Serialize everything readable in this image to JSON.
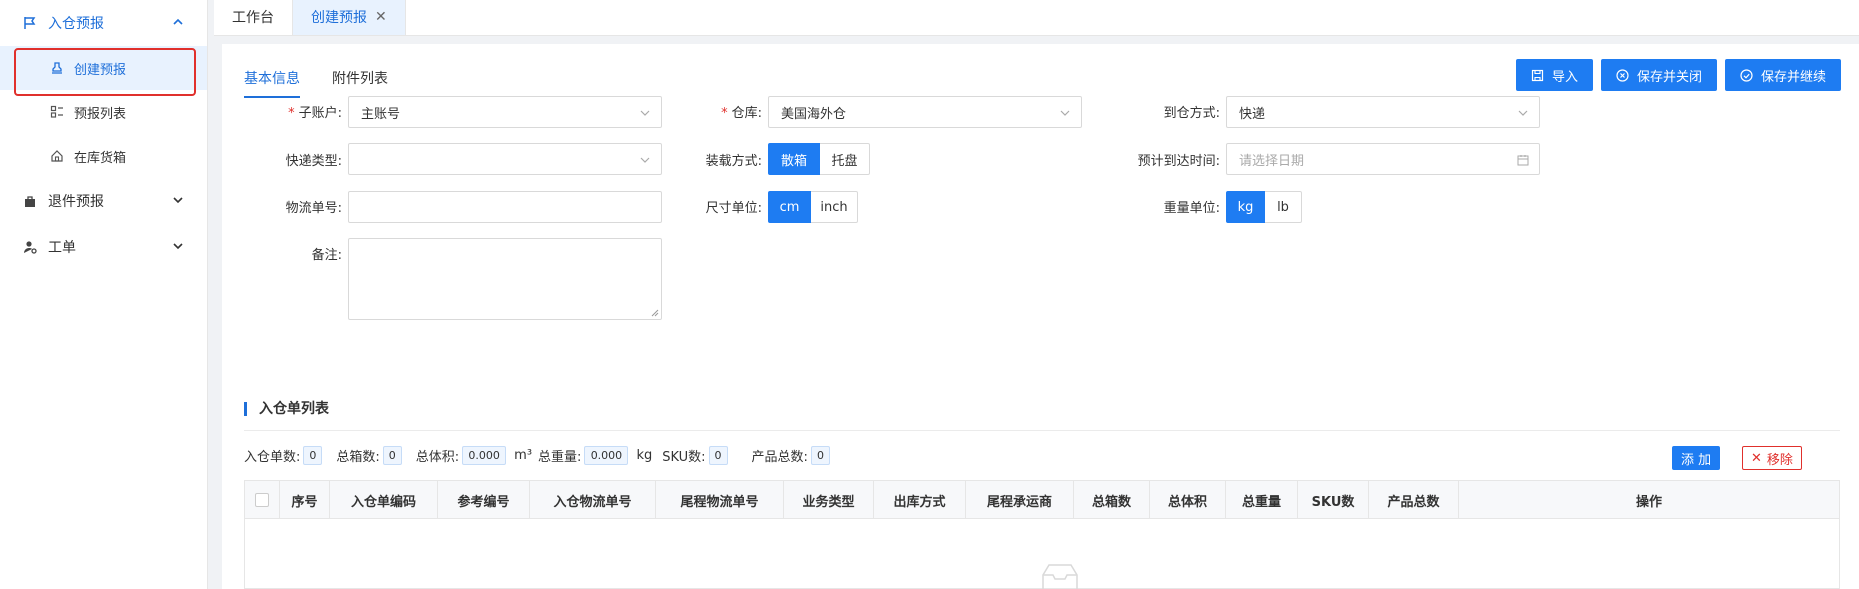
{
  "sidebar": {
    "groups": [
      {
        "label": "入仓预报",
        "icon": "flag-icon",
        "expanded": true
      },
      {
        "label": "退件预报",
        "icon": "bag-icon",
        "expanded": false
      },
      {
        "label": "工单",
        "icon": "user-gear-icon",
        "expanded": false
      }
    ],
    "items": [
      {
        "label": "创建预报",
        "icon": "stamp-icon",
        "active": true
      },
      {
        "label": "预报列表",
        "icon": "list-icon",
        "active": false
      },
      {
        "label": "在库货箱",
        "icon": "home-icon",
        "active": false
      }
    ]
  },
  "tabs": {
    "workbench": "工作台",
    "create": "创建预报"
  },
  "subtabs": {
    "basic": "基本信息",
    "attachments": "附件列表"
  },
  "actions": {
    "import": "导入",
    "save_close": "保存并关闭",
    "save_continue": "保存并继续"
  },
  "form": {
    "sub_account_label": "子账户:",
    "sub_account_value": "主账号",
    "warehouse_label": "仓库:",
    "warehouse_value": "美国海外仓",
    "arrival_mode_label": "到仓方式:",
    "arrival_mode_value": "快递",
    "express_type_label": "快递类型:",
    "express_type_value": "",
    "loading_label": "装载方式:",
    "loading_options": [
      "散箱",
      "托盘"
    ],
    "eta_label": "预计到达时间:",
    "eta_placeholder": "请选择日期",
    "tracking_label": "物流单号:",
    "tracking_value": "",
    "size_unit_label": "尺寸单位:",
    "size_unit_options": [
      "cm",
      "inch"
    ],
    "weight_unit_label": "重量单位:",
    "weight_unit_options": [
      "kg",
      "lb"
    ],
    "remark_label": "备注:",
    "remark_value": ""
  },
  "inbound_section": {
    "title": "入仓单列表",
    "stats": {
      "orders_label": "入仓单数:",
      "orders": "0",
      "boxes_label": "总箱数:",
      "boxes": "0",
      "volume_label": "总体积:",
      "volume": "0.000",
      "volume_unit": "m³",
      "weight_label": "总重量:",
      "weight": "0.000",
      "weight_unit": "kg",
      "sku_label": "SKU数:",
      "sku": "0",
      "products_label": "产品总数:",
      "products": "0"
    },
    "add": "添 加",
    "remove": "移除",
    "columns": [
      "序号",
      "入仓单编码",
      "参考编号",
      "入仓物流单号",
      "尾程物流单号",
      "业务类型",
      "出库方式",
      "尾程承运商",
      "总箱数",
      "总体积",
      "总重量",
      "SKU数",
      "产品总数",
      "操作"
    ]
  },
  "colors": {
    "primary": "#1e7cf2",
    "danger": "#e0302c"
  }
}
